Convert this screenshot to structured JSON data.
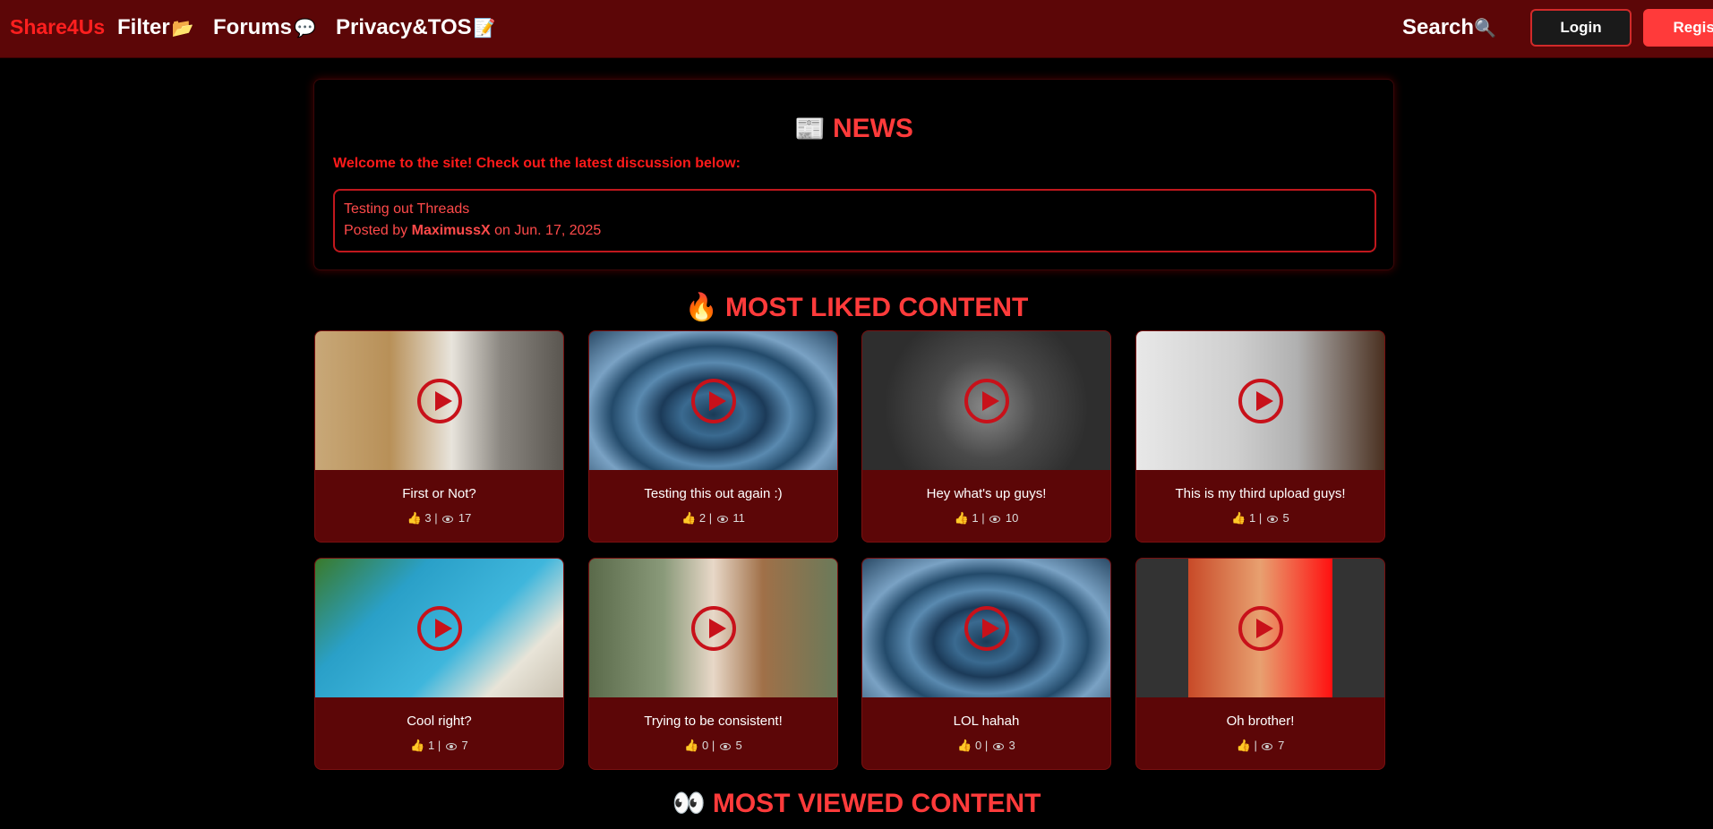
{
  "nav": {
    "brand": "Share4Us",
    "links": [
      {
        "label": "Filter",
        "emoji": "📂"
      },
      {
        "label": "Forums",
        "emoji": "💬"
      },
      {
        "label": "Privacy&TOS",
        "emoji": "📝"
      }
    ],
    "search_label": "Search",
    "search_emoji": "🔍",
    "login_label": "Login",
    "register_label": "Register"
  },
  "news": {
    "emoji": "📰",
    "title": "NEWS",
    "welcome": "Welcome to the site! Check out the latest discussion below:",
    "thread": {
      "title": "Testing out Threads",
      "posted_by_prefix": "Posted by",
      "author": "MaximussX",
      "date_text": "on Jun. 17, 2025"
    }
  },
  "most_liked": {
    "emoji": "🔥",
    "title": "MOST LIKED CONTENT",
    "cards": [
      {
        "title": "First or Not?",
        "likes": "3",
        "views": "17",
        "thumb": "cat"
      },
      {
        "title": "Testing this out again :)",
        "likes": "2",
        "views": "11",
        "thumb": "water-ripple"
      },
      {
        "title": "Hey what's up guys!",
        "likes": "1",
        "views": "10",
        "thumb": "anime-character"
      },
      {
        "title": "This is my third upload guys!",
        "likes": "1",
        "views": "5",
        "thumb": "water-glass"
      },
      {
        "title": "Cool right?",
        "likes": "1",
        "views": "7",
        "thumb": "pool"
      },
      {
        "title": "Trying to be consistent!",
        "likes": "0",
        "views": "5",
        "thumb": "dog-basket"
      },
      {
        "title": "LOL hahah",
        "likes": "0",
        "views": "3",
        "thumb": "water-ripple"
      },
      {
        "title": "Oh brother!",
        "likes": "",
        "views": "7",
        "thumb": "anime-soldier"
      }
    ]
  },
  "most_viewed": {
    "emoji": "👀",
    "title": "MOST VIEWED CONTENT"
  },
  "stats_separator": "|",
  "colors": {
    "navbar_bg": "#5c0607",
    "accent_red": "#ff3b3b",
    "card_bg": "#5c0607",
    "play_icon": "#c8111a"
  }
}
